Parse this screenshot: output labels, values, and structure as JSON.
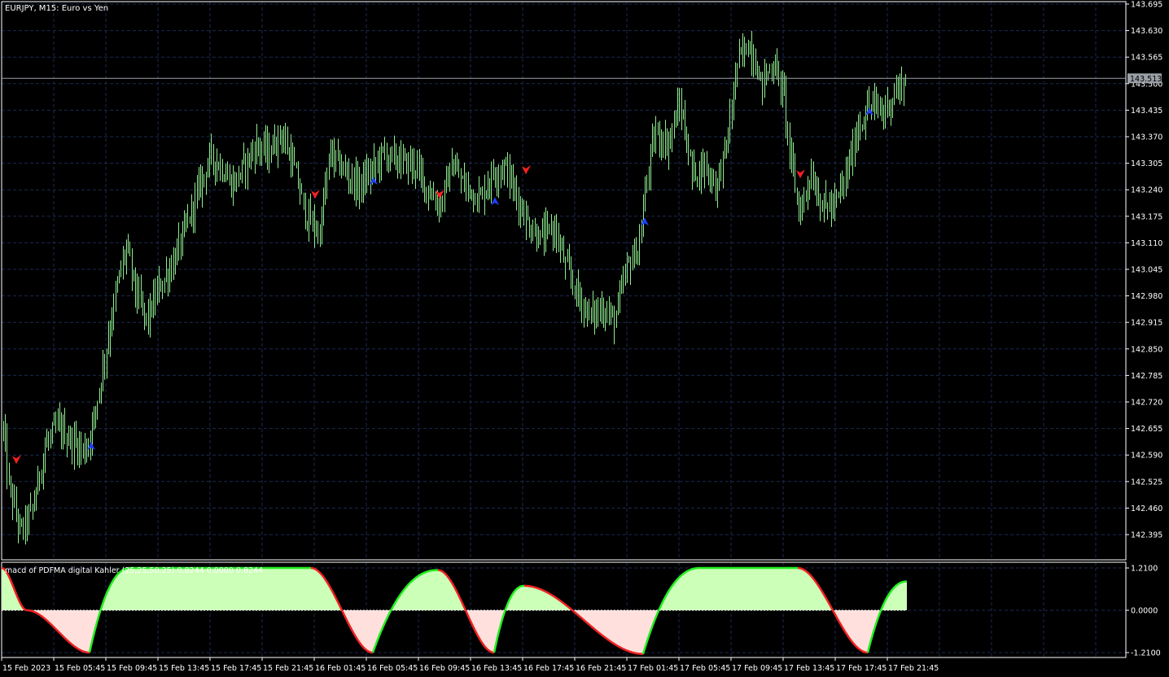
{
  "main": {
    "title": "EURJPY, M15:  Euro vs Yen",
    "current_price": "143.513",
    "y_ticks": [
      "143.695",
      "143.630",
      "143.565",
      "143.500",
      "143.435",
      "143.370",
      "143.305",
      "143.240",
      "143.175",
      "143.110",
      "143.045",
      "142.980",
      "142.915",
      "142.850",
      "142.785",
      "142.720",
      "142.655",
      "142.590",
      "142.525",
      "142.460",
      "142.395"
    ]
  },
  "indicator": {
    "title": "macd of PDFMA digital Kahler (25,25,50,25) 0.8244 0.0000 0.8244",
    "y_ticks": [
      "1.2100",
      "0.0000",
      "-1.2100"
    ]
  },
  "x_ticks": [
    "15 Feb 2023",
    "15 Feb 05:45",
    "15 Feb 09:45",
    "15 Feb 13:45",
    "15 Feb 17:45",
    "15 Feb 21:45",
    "16 Feb 01:45",
    "16 Feb 05:45",
    "16 Feb 09:45",
    "16 Feb 13:45",
    "16 Feb 17:45",
    "16 Feb 21:45",
    "17 Feb 01:45",
    "17 Feb 05:45",
    "17 Feb 09:45",
    "17 Feb 13:45",
    "17 Feb 17:45",
    "17 Feb 21:45"
  ],
  "colors": {
    "background": "#000000",
    "grid": "#1c2a52",
    "candles": "#90ee90",
    "buy_arrow": "#1f3fff",
    "sell_arrow": "#ff2020",
    "macd_up": "#22ee22",
    "macd_down": "#ee2222",
    "macd_pos_fill": "#ccffb8",
    "macd_neg_fill": "#ffe0dc"
  },
  "chart_data": [
    {
      "type": "candlestick",
      "title": "EURJPY, M15:  Euro vs Yen",
      "ylim": [
        142.33,
        143.71
      ],
      "close_path": [
        [
          0,
          142.74
        ],
        [
          10,
          142.52
        ],
        [
          25,
          142.4
        ],
        [
          40,
          142.46
        ],
        [
          55,
          142.61
        ],
        [
          70,
          142.66
        ],
        [
          90,
          142.62
        ],
        [
          105,
          142.6
        ],
        [
          115,
          142.68
        ],
        [
          130,
          142.85
        ],
        [
          145,
          143.02
        ],
        [
          155,
          143.1
        ],
        [
          168,
          142.98
        ],
        [
          180,
          142.92
        ],
        [
          195,
          143.0
        ],
        [
          210,
          143.05
        ],
        [
          225,
          143.13
        ],
        [
          245,
          143.25
        ],
        [
          258,
          143.32
        ],
        [
          270,
          143.3
        ],
        [
          285,
          143.25
        ],
        [
          300,
          143.3
        ],
        [
          315,
          143.35
        ],
        [
          330,
          143.33
        ],
        [
          345,
          143.38
        ],
        [
          360,
          143.3
        ],
        [
          375,
          143.18
        ],
        [
          392,
          143.13
        ],
        [
          405,
          143.33
        ],
        [
          425,
          143.28
        ],
        [
          440,
          143.25
        ],
        [
          455,
          143.28
        ],
        [
          470,
          143.33
        ],
        [
          490,
          143.31
        ],
        [
          510,
          143.3
        ],
        [
          525,
          143.24
        ],
        [
          540,
          143.2
        ],
        [
          555,
          143.3
        ],
        [
          570,
          143.25
        ],
        [
          590,
          143.22
        ],
        [
          605,
          143.28
        ],
        [
          620,
          143.3
        ],
        [
          635,
          143.22
        ],
        [
          650,
          143.15
        ],
        [
          665,
          143.12
        ],
        [
          680,
          143.15
        ],
        [
          695,
          143.05
        ],
        [
          710,
          142.98
        ],
        [
          725,
          142.93
        ],
        [
          740,
          142.95
        ],
        [
          755,
          142.92
        ],
        [
          770,
          143.05
        ],
        [
          785,
          143.1
        ],
        [
          795,
          143.28
        ],
        [
          805,
          143.38
        ],
        [
          820,
          143.35
        ],
        [
          835,
          143.45
        ],
        [
          850,
          143.28
        ],
        [
          865,
          143.3
        ],
        [
          880,
          143.25
        ],
        [
          895,
          143.38
        ],
        [
          905,
          143.55
        ],
        [
          920,
          143.6
        ],
        [
          935,
          143.5
        ],
        [
          950,
          143.55
        ],
        [
          962,
          143.48
        ],
        [
          972,
          143.3
        ],
        [
          982,
          143.18
        ],
        [
          995,
          143.28
        ],
        [
          1010,
          143.2
        ],
        [
          1025,
          143.2
        ],
        [
          1040,
          143.28
        ],
        [
          1055,
          143.4
        ],
        [
          1070,
          143.45
        ],
        [
          1085,
          143.43
        ],
        [
          1100,
          143.48
        ],
        [
          1112,
          143.51
        ]
      ],
      "signals": [
        {
          "x": 20,
          "price": 142.58,
          "direction": "sell"
        },
        {
          "x": 112,
          "price": 142.61,
          "direction": "buy"
        },
        {
          "x": 387,
          "price": 143.23,
          "direction": "sell"
        },
        {
          "x": 459,
          "price": 143.26,
          "direction": "buy"
        },
        {
          "x": 540,
          "price": 143.23,
          "direction": "sell"
        },
        {
          "x": 608,
          "price": 143.21,
          "direction": "buy"
        },
        {
          "x": 646,
          "price": 143.29,
          "direction": "sell"
        },
        {
          "x": 792,
          "price": 143.16,
          "direction": "buy"
        },
        {
          "x": 983,
          "price": 143.28,
          "direction": "sell"
        },
        {
          "x": 1068,
          "price": 143.43,
          "direction": "buy"
        }
      ]
    },
    {
      "type": "area",
      "title": "macd of PDFMA digital Kahler (25,25,50,25) 0.8244 0.0000 0.8244",
      "ylim": [
        -1.21,
        1.21
      ],
      "zero_line": 0.0,
      "segments": [
        {
          "x0": 2,
          "x1": 33,
          "from": 1.21,
          "to": 0.0,
          "dir": "down"
        },
        {
          "x0": 33,
          "x1": 110,
          "from": 0.0,
          "to": -1.21,
          "dir": "down"
        },
        {
          "x0": 110,
          "x1": 160,
          "from": -1.21,
          "to": 1.21,
          "dir": "up"
        },
        {
          "x0": 160,
          "x1": 382,
          "from": 1.21,
          "to": 1.21,
          "dir": "flat"
        },
        {
          "x0": 382,
          "x1": 458,
          "from": 1.21,
          "to": -1.21,
          "dir": "down"
        },
        {
          "x0": 458,
          "x1": 538,
          "from": -1.21,
          "to": 1.15,
          "dir": "up"
        },
        {
          "x0": 538,
          "x1": 607,
          "from": 1.15,
          "to": -1.21,
          "dir": "down"
        },
        {
          "x0": 607,
          "x1": 644,
          "from": -1.21,
          "to": 0.7,
          "dir": "up"
        },
        {
          "x0": 644,
          "x1": 790,
          "from": 0.7,
          "to": -1.25,
          "dir": "down"
        },
        {
          "x0": 790,
          "x1": 860,
          "from": -1.25,
          "to": 1.21,
          "dir": "up"
        },
        {
          "x0": 860,
          "x1": 980,
          "from": 1.21,
          "to": 1.21,
          "dir": "flat"
        },
        {
          "x0": 980,
          "x1": 1066,
          "from": 1.21,
          "to": -1.21,
          "dir": "down"
        },
        {
          "x0": 1066,
          "x1": 1114,
          "from": -1.21,
          "to": 0.8244,
          "dir": "up"
        }
      ]
    }
  ]
}
